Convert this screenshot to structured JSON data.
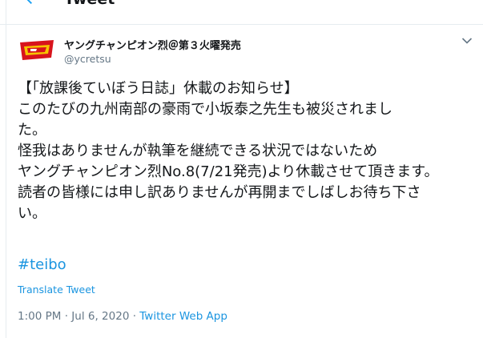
{
  "topbar": {
    "title": "Tweet"
  },
  "tweet": {
    "author": {
      "display_name": "ヤングチャンピオン烈＠第３火曜発売",
      "handle": "@ycretsu"
    },
    "body": "【「放課後ていぼう日誌」休載のお知らせ】\nこのたびの九州南部の豪雨で小坂泰之先生も被災されまし\nた。\n怪我はありませんが執筆を継続できる状況ではないため\nヤングチャンピオン烈No.8(7/21発売)より休載させて頂きます。\n読者の皆様には申し訳ありませんが再開までしばしお待ち下さ\nい。",
    "hashtag": "#teibo",
    "translate_label": "Translate Tweet",
    "time": "1:00 PM",
    "separator": "·",
    "date": "Jul 6, 2020",
    "source": "Twitter Web App"
  },
  "colors": {
    "link": "#1b95e0",
    "muted": "#657786",
    "text": "#14171a",
    "border": "#e6ecf0"
  },
  "icons": {
    "back": "arrow-left-icon",
    "menu": "chevron-down-icon"
  }
}
